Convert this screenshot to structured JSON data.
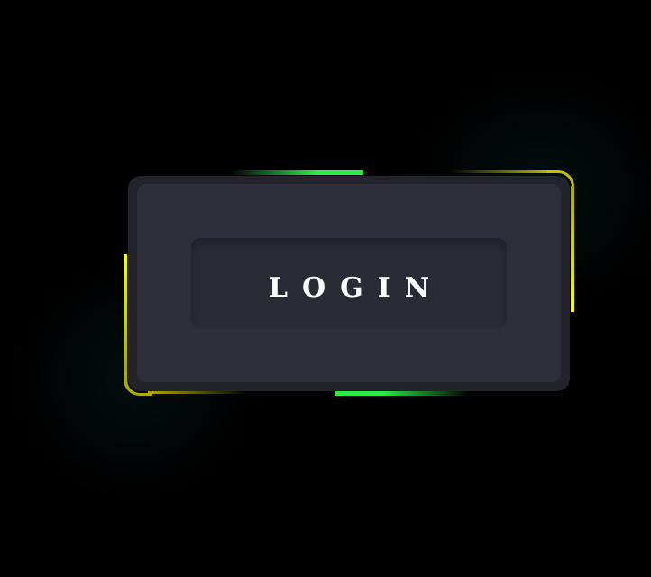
{
  "login_button": {
    "label": "LOGIN"
  },
  "colors": {
    "background": "#000000",
    "card_outer": "#23232b",
    "card_inner": "#2f2f3b",
    "button": "#2b2b36",
    "accent_yellow": "#ffff00",
    "accent_green": "#2fe84a",
    "text": "#ffffff"
  }
}
